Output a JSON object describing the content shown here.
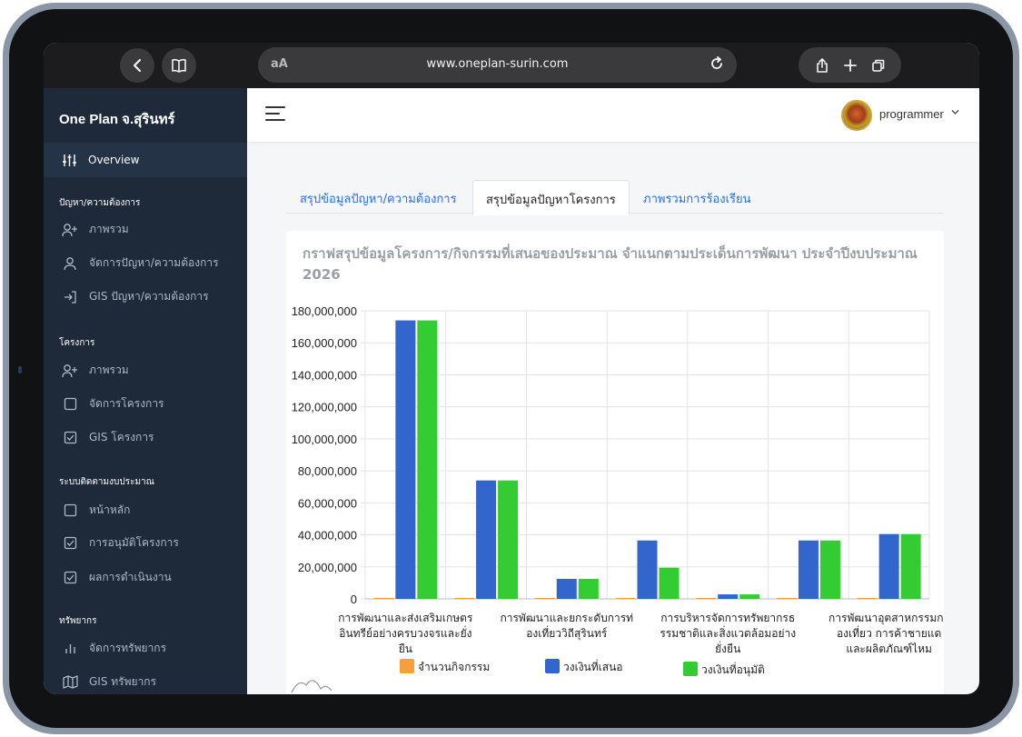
{
  "browser": {
    "url": "www.oneplan-surin.com",
    "reader_label": "aA"
  },
  "sidebar": {
    "brand": "One Plan จ.สุรินทร์",
    "overview_label": "Overview",
    "sections": [
      {
        "heading": "ปัญหา/ความต้องการ",
        "items": [
          {
            "label": "ภาพรวม",
            "icon": "user-plus-icon"
          },
          {
            "label": "จัดการปัญหา/ความต้องการ",
            "icon": "user-icon"
          },
          {
            "label": "GIS ปัญหา/ความต้องการ",
            "icon": "sign-in-icon"
          }
        ]
      },
      {
        "heading": "โครงการ",
        "items": [
          {
            "label": "ภาพรวม",
            "icon": "user-plus-icon"
          },
          {
            "label": "จัดการโครงการ",
            "icon": "square-icon"
          },
          {
            "label": "GIS โครงการ",
            "icon": "check-square-icon"
          }
        ]
      },
      {
        "heading": "ระบบติดตามงบประมาณ",
        "items": [
          {
            "label": "หน้าหลัก",
            "icon": "square-icon"
          },
          {
            "label": "การอนุมัติโครงการ",
            "icon": "check-square-icon"
          },
          {
            "label": "ผลการดำเนินงาน",
            "icon": "check-square-icon"
          }
        ]
      },
      {
        "heading": "ทรัพยากร",
        "items": [
          {
            "label": "จัดการทรัพยากร",
            "icon": "bar-chart-icon"
          },
          {
            "label": "GIS ทรัพยากร",
            "icon": "map-icon"
          }
        ]
      }
    ]
  },
  "header": {
    "username": "programmer"
  },
  "tabs": [
    {
      "label": "สรุปข้อมูลปัญหา/ความต้องการ",
      "active": false
    },
    {
      "label": "สรุปข้อมูลปัญหาโครงการ",
      "active": true
    },
    {
      "label": "ภาพรวมการร้องเรียน",
      "active": false
    }
  ],
  "chart_data": {
    "type": "bar",
    "title": "กราฟสรุปข้อมูลโครงการ/กิจกรรมที่เสนอของประมาณ จำแนกตามประเด็นการพัฒนา ประจำปีงบประมาณ 2026",
    "categories": [
      [
        "การพัฒนาและส่งเสริมเกษตร",
        "อินทรีย์อย่างครบวงจรและยั่ง",
        "ยืน"
      ],
      [],
      [
        "การพัฒนาและยกระดับการท่",
        "องเที่ยววิถีสุรินทร์"
      ],
      [],
      [
        "การบริหารจัดการทรัพยากรธ",
        "รรมชาติและสิ่งแวดล้อมอย่าง",
        "ยั่งยืน"
      ],
      [],
      [
        "การพัฒนาอุตสาหกรรมกา",
        "องเที่ยว การค้าชายแด",
        "และผลิตภัณฑ์ไหม"
      ]
    ],
    "series": [
      {
        "name": "จำนวนกิจกรรม",
        "color": "#f5a03a",
        "values": [
          0,
          0,
          0,
          0,
          0,
          0,
          0
        ]
      },
      {
        "name": "วงเงินที่เสนอ",
        "color": "#3366cc",
        "values": [
          174000000,
          74000000,
          12500000,
          36500000,
          2800000,
          36500000,
          40500000
        ]
      },
      {
        "name": "วงเงินที่อนุมัติ",
        "color": "#33cc33",
        "values": [
          174000000,
          74000000,
          12500000,
          19500000,
          2800000,
          36500000,
          40500000
        ]
      }
    ],
    "ylim": [
      0,
      180000000
    ],
    "yticks": [
      "0",
      "20,000,000",
      "40,000,000",
      "60,000,000",
      "80,000,000",
      "100,000,000",
      "120,000,000",
      "140,000,000",
      "160,000,000",
      "180,000,000"
    ],
    "grid": true,
    "legend": "bottom"
  }
}
